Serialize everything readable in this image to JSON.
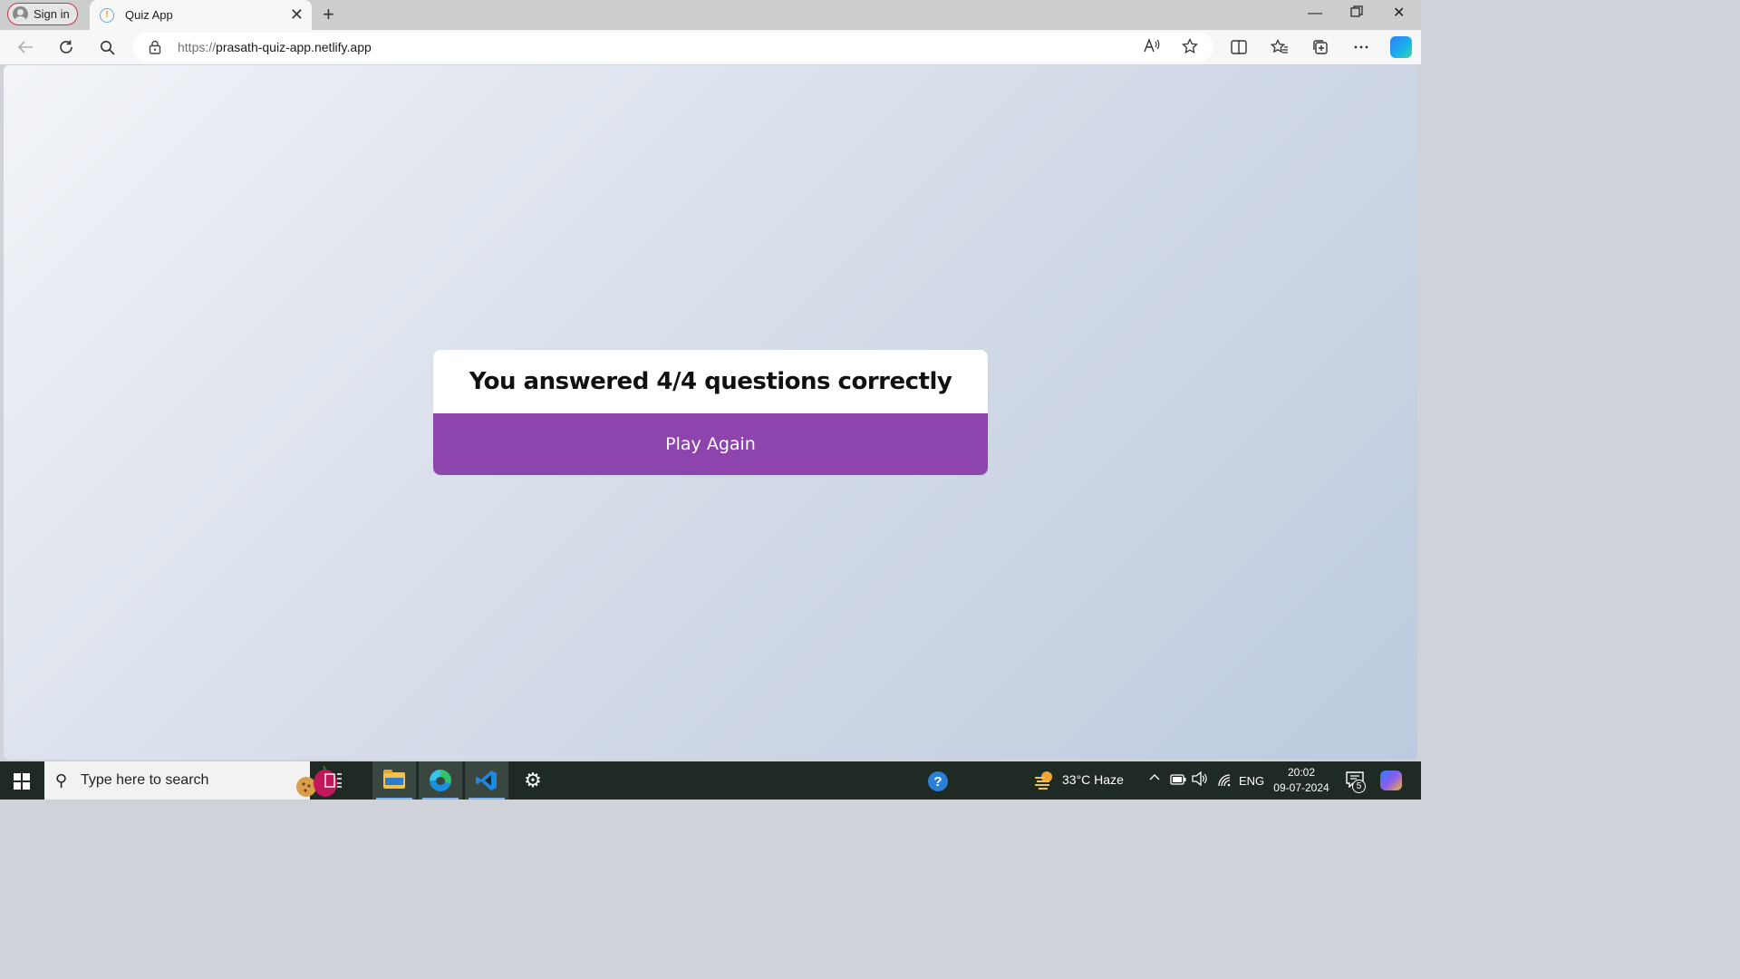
{
  "browser": {
    "signin_label": "Sign in",
    "tab": {
      "title": "Quiz App"
    },
    "url": {
      "protocol": "https://",
      "host": "prasath-quiz-app.netlify.app"
    }
  },
  "page": {
    "result_text": "You answered 4/4 questions correctly",
    "play_again_label": "Play Again",
    "accent_color": "#8e44ad"
  },
  "taskbar": {
    "search_placeholder": "Type here to search",
    "weather": "33°C  Haze",
    "language": "ENG",
    "time": "20:02",
    "date": "09-07-2024",
    "notification_count": "5"
  }
}
